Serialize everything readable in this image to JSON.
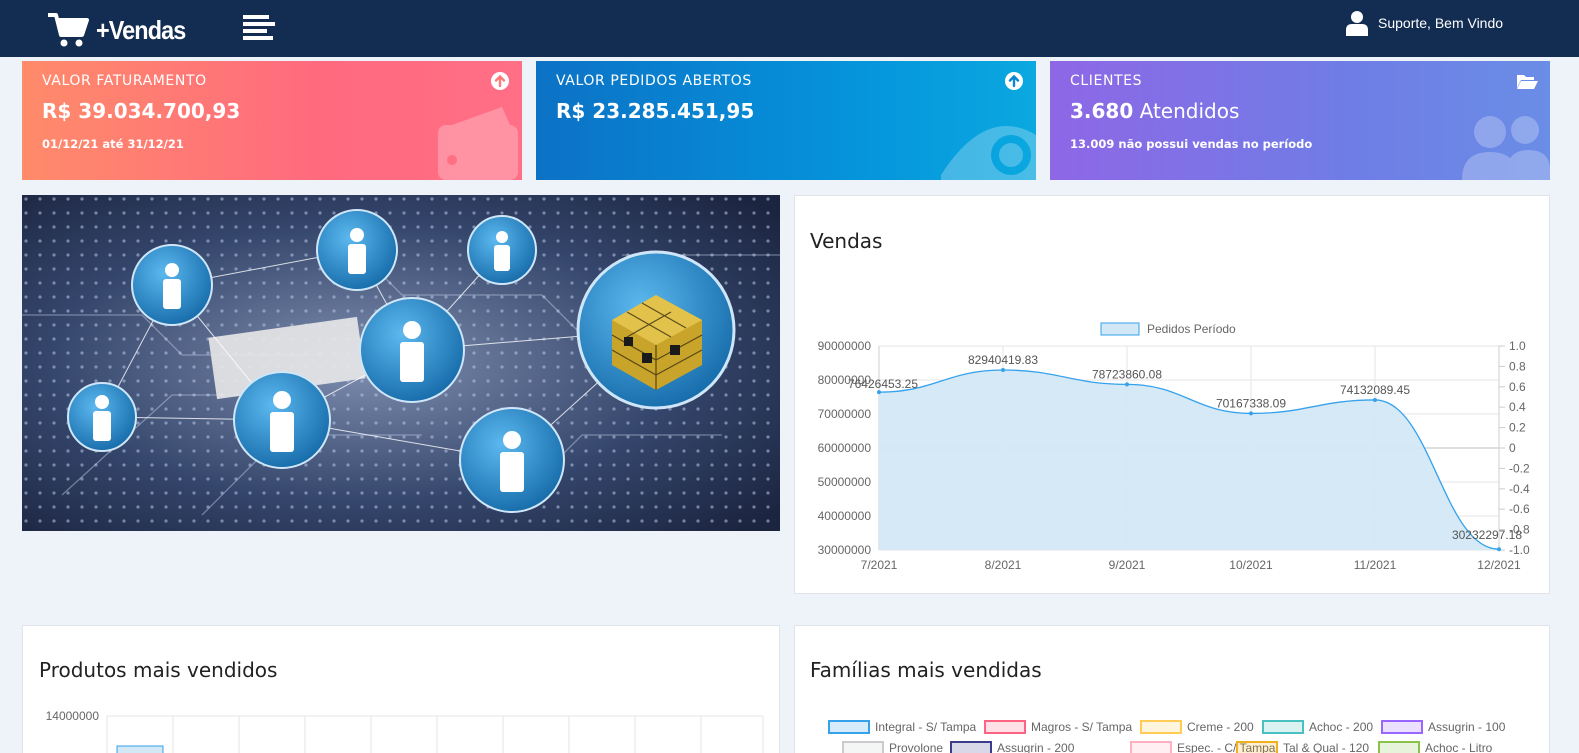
{
  "header": {
    "brand": "+Vendas",
    "user_greeting": "Suporte, Bem Vindo",
    "icons": [
      "cart-icon",
      "menu-icon",
      "user-icon"
    ]
  },
  "cards": [
    {
      "label": "VALOR FATURAMENTO",
      "value": "R$ 39.034.700,93",
      "sub": "01/12/21 até 31/12/21",
      "icon": "arrow-up-circle-icon",
      "bg_icon": "wallet-icon"
    },
    {
      "label": "VALOR PEDIDOS ABERTOS",
      "value": "R$ 23.285.451,95",
      "sub": "",
      "icon": "arrow-up-circle-icon",
      "bg_icon": "eye-icon"
    },
    {
      "label": "CLIENTES",
      "value_bold": "3.680",
      "value_rest": " Atendidos",
      "sub": "13.009 não possui vendas no período",
      "icon": "folder-open-icon",
      "bg_icon": "users-icon"
    }
  ],
  "colors": {
    "topbar": "#132c51",
    "card1": "#ff7a78",
    "card2": "#0a86d2",
    "card3": "#7a74e6",
    "chart_line": "#36a2eb",
    "chart_fill": "#d3e8f6"
  },
  "vendas": {
    "title": "Vendas"
  },
  "chart_data": {
    "type": "area",
    "title": "Vendas",
    "x": [
      "7/2021",
      "8/2021",
      "9/2021",
      "10/2021",
      "11/2021",
      "12/2021"
    ],
    "series": [
      {
        "name": "Pedidos Período",
        "values": [
          76426453.25,
          82940419.83,
          78723860.08,
          70167338.09,
          74132089.45,
          30232297.18
        ]
      }
    ],
    "data_labels": [
      "76426453.25",
      "82940419.83",
      "78723860.08",
      "70167338.09",
      "74132089.45",
      "30232297.18"
    ],
    "y_ticks": [
      "90000000",
      "80000000",
      "70000000",
      "60000000",
      "50000000",
      "40000000",
      "30000000"
    ],
    "y2_ticks": [
      "1.0",
      "0.8",
      "0.6",
      "0.4",
      "0.2",
      "0",
      "-0.2",
      "-0.4",
      "-0.6",
      "-0.8",
      "-1.0"
    ],
    "ylim": [
      30000000,
      90000000
    ],
    "y2lim": [
      -1.0,
      1.0
    ],
    "grid": true,
    "legend_position": "top"
  },
  "produtos": {
    "title": "Produtos mais vendidos",
    "y_tick_top": "14000000"
  },
  "familias": {
    "title": "Famílias mais vendidas",
    "legend": [
      {
        "label": "Integral - S/ Tampa",
        "color": "#36a2eb"
      },
      {
        "label": "Magros - S/ Tampa",
        "color": "#ff6384"
      },
      {
        "label": "Creme - 200",
        "color": "#ffcd56"
      },
      {
        "label": "Achoc - 200",
        "color": "#4bc0c0"
      },
      {
        "label": "Assugrin - 100",
        "color": "#9966ff"
      },
      {
        "label": "Provolone",
        "color": "#c9cbcf"
      },
      {
        "label": "Assugrin - 200",
        "color": "#3b3d8a"
      },
      {
        "label": "Espec. - C/ Tampa",
        "color": "#ffb1c1"
      },
      {
        "label": "Tal & Qual - 120",
        "color": "#f0b020"
      },
      {
        "label": "Achoc - Litro",
        "color": "#8bc34a"
      }
    ]
  }
}
